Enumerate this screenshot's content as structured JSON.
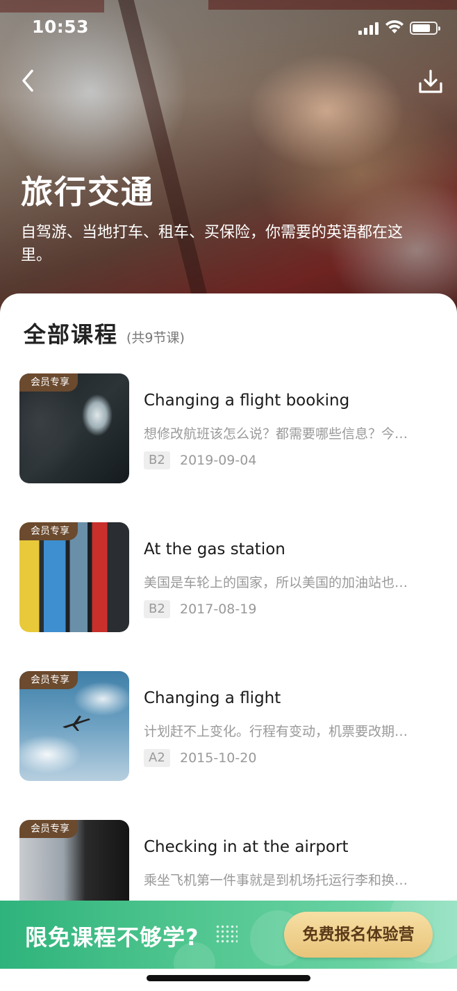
{
  "status_bar": {
    "time": "10:53"
  },
  "header": {
    "title": "旅行交通",
    "description": "自驾游、当地打车、租车、买保险，你需要的英语都在这里。",
    "back_icon": "chevron-left-icon",
    "download_icon": "download-icon"
  },
  "section": {
    "title": "全部课程",
    "count": "(共9节课)"
  },
  "vip_tag": "会员专享",
  "courses": [
    {
      "title": "Changing a flight booking",
      "desc": "想修改航班该怎么说？都需要哪些信息？今…",
      "level": "B2",
      "date": "2019-09-04"
    },
    {
      "title": "At the gas station",
      "desc": "美国是车轮上的国家，所以美国的加油站也…",
      "level": "B2",
      "date": "2017-08-19"
    },
    {
      "title": "Changing a flight",
      "desc": "计划赶不上变化。行程有变动，机票要改期…",
      "level": "A2",
      "date": "2015-10-20"
    },
    {
      "title": "Checking in at the airport",
      "desc": "乘坐飞机第一件事就是到机场托运行李和换…",
      "level": "",
      "date": ""
    }
  ],
  "promo": {
    "text": "限免课程不够学?",
    "button": "免费报名体验营"
  },
  "colors": {
    "promo_green": "#3dbb84",
    "button_gold": "#eccb84",
    "vip_brown": "#6b4a2e"
  }
}
